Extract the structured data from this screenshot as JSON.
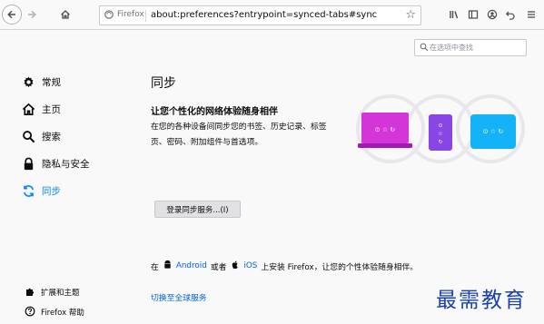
{
  "browser": {
    "identity_label": "Firefox",
    "url": "about:preferences?entrypoint=synced-tabs#sync"
  },
  "search": {
    "placeholder": "在选项中查找"
  },
  "sidebar": {
    "items": [
      {
        "label": "常规",
        "icon": "gear-icon"
      },
      {
        "label": "主页",
        "icon": "home-icon"
      },
      {
        "label": "搜索",
        "icon": "search-icon"
      },
      {
        "label": "隐私与安全",
        "icon": "lock-icon"
      },
      {
        "label": "同步",
        "icon": "sync-icon",
        "active": true
      }
    ],
    "footer": [
      {
        "label": "扩展和主题",
        "icon": "puzzle-icon"
      },
      {
        "label": "Firefox 帮助",
        "icon": "help-icon"
      }
    ]
  },
  "main": {
    "title": "同步",
    "heading": "让您个性化的网络体验随身相伴",
    "description": "在您的各种设备间同步您的书签、历史记录、标签页、密码、附加组件与首选项。",
    "signin_label": "登录同步服务...(I)",
    "mobile": {
      "prefix": "在",
      "android": "Android",
      "or": "或者",
      "ios": "iOS",
      "suffix": "上安装 Firefox，让您的个性体验随身相伴。"
    },
    "switch_link": "切换至全球服务"
  },
  "watermark_text": "最需教育",
  "colors": {
    "accent": "#0a84ff",
    "link": "#0060df",
    "laptop": "#d335d8",
    "phone": "#8a45e6",
    "tablet": "#14b3f7"
  }
}
